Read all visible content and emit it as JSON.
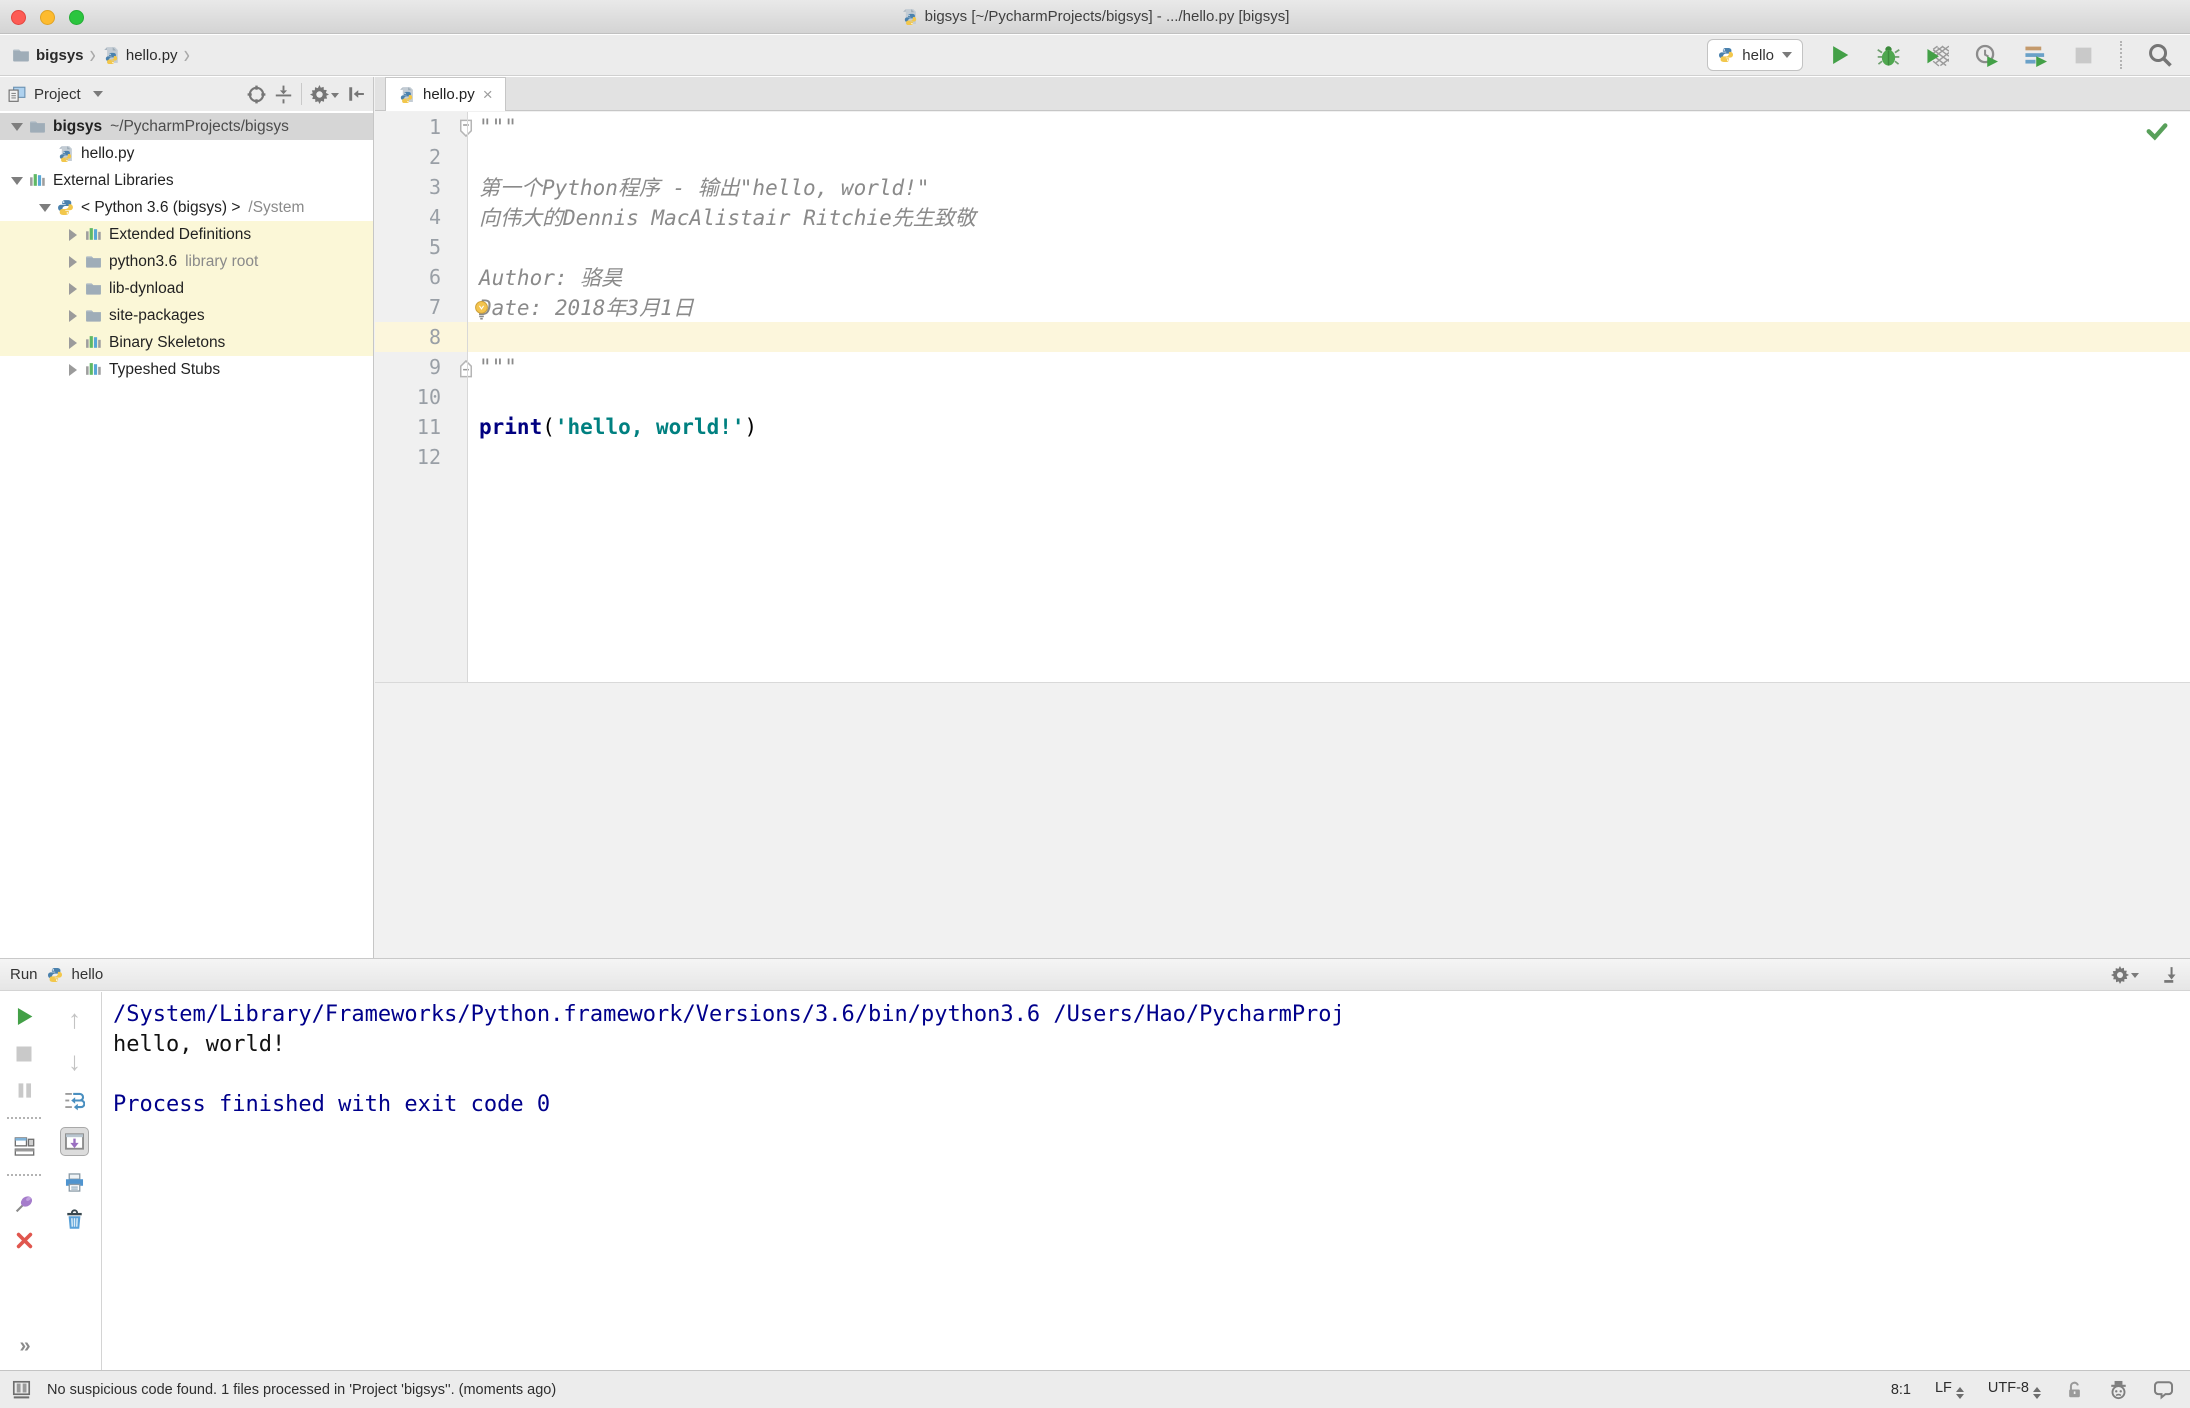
{
  "title_bar": {
    "title": "bigsys [~/PycharmProjects/bigsys] - .../hello.py [bigsys]"
  },
  "toolbar": {
    "breadcrumbs": [
      {
        "label": "bigsys"
      },
      {
        "label": "hello.py"
      }
    ],
    "run_config": {
      "label": "hello"
    },
    "icons": [
      "run-icon",
      "debug-icon",
      "coverage-icon",
      "profiler-icon",
      "concurrency-icon",
      "stop-icon",
      "search-icon"
    ]
  },
  "project": {
    "header": {
      "title": "Project",
      "icons": [
        "locate-icon",
        "collapse-all-icon",
        "gear-icon",
        "hide-panel-icon"
      ]
    },
    "tree": [
      {
        "label": "bigsys",
        "hint": "~/PycharmProjects/bigsys"
      },
      {
        "label": "hello.py",
        "hint": ""
      },
      {
        "label": "External Libraries",
        "hint": ""
      },
      {
        "label": "< Python 3.6 (bigsys) >",
        "hint": "/System"
      },
      {
        "label": "Extended Definitions",
        "hint": ""
      },
      {
        "label": "python3.6",
        "hint": "library root"
      },
      {
        "label": "lib-dynload",
        "hint": ""
      },
      {
        "label": "site-packages",
        "hint": ""
      },
      {
        "label": "Binary Skeletons",
        "hint": ""
      },
      {
        "label": "Typeshed Stubs",
        "hint": ""
      }
    ]
  },
  "editor": {
    "tab": {
      "label": "hello.py"
    },
    "line_numbers": [
      "1",
      "2",
      "3",
      "4",
      "5",
      "6",
      "7",
      "8",
      "9",
      "10",
      "11",
      "12"
    ],
    "code": {
      "doc_quote": "\"\"\"",
      "line3": "第一个Python程序 - 输出\"hello, world!\"",
      "line4": "向伟大的Dennis MacAlistair Ritchie先生致敬",
      "line6": "Author: 骆昊",
      "line7": "Date: 2018年3月1日",
      "print_kw": "print",
      "paren_open": "(",
      "string_arg": "'hello, world!'",
      "paren_close": ")"
    },
    "status_icon": "inspections-ok-check"
  },
  "run": {
    "title": "Run",
    "config": "hello",
    "header_icons": [
      "gear-icon",
      "hide-panel-down-icon"
    ],
    "left_icons_col1": [
      "rerun-icon",
      "stop-icon",
      "pause-icon",
      "restore-layout-icon",
      "pin-icon",
      "close-icon",
      "more-icon"
    ],
    "left_icons_col2": [
      "up-stack-icon",
      "down-stack-icon",
      "soft-wrap-icon",
      "scroll-to-end-icon",
      "print-icon",
      "clear-all-icon"
    ],
    "console": [
      {
        "text": "/System/Library/Frameworks/Python.framework/Versions/3.6/bin/python3.6 /Users/Hao/PycharmProj",
        "color": "blue"
      },
      {
        "text": "hello, world!",
        "color": "black"
      },
      {
        "text": "",
        "color": "black"
      },
      {
        "text": "Process finished with exit code 0",
        "color": "blue"
      }
    ]
  },
  "status": {
    "message": "No suspicious code found. 1 files processed in 'Project 'bigsys''. (moments ago)",
    "caret_pos": "8:1",
    "line_sep": "LF",
    "encoding": "UTF-8",
    "right_icons": [
      "unlock-icon",
      "hector-inspector-icon",
      "event-bubble-icon"
    ]
  },
  "colors": {
    "keyword": "#000080",
    "string": "#008080",
    "docstring": "#8a8a8a",
    "console_info": "#00008b",
    "run_green": "#43a047",
    "tree_selection": "#d6d6d6",
    "tree_highlight": "#fbf7d7",
    "current_line": "#fcf6dc"
  }
}
